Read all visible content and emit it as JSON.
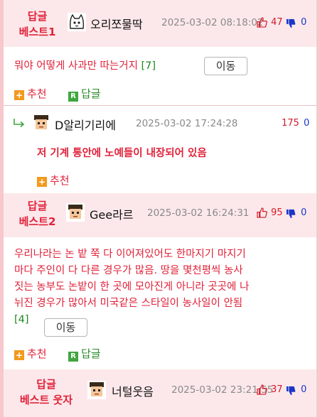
{
  "comments": [
    {
      "badge_line1": "답글",
      "badge_line2": "베스트1",
      "nickname": "오리쪼물딱",
      "avatar_icon": "cat-avatar-icon",
      "date": "2025-03-02 08:18:02",
      "up": "47",
      "down": "0",
      "text": "뭐야 어떻게 사과만 따는거지",
      "count": "[7]",
      "move_label": "이동",
      "recommend_label": "추천",
      "reply_label": "답글"
    },
    {
      "nickname": "D알리기리에",
      "avatar_icon": "pixel-face-avatar-icon",
      "date": "2025-03-02 17:24:28",
      "up": "175",
      "down": "0",
      "text": "저 기계 통안에 노예들이 내장되어 있음",
      "recommend_label": "추천"
    },
    {
      "badge_line1": "답글",
      "badge_line2": "베스트2",
      "nickname": "Gee라르",
      "avatar_icon": "pixel-face-avatar-icon",
      "date": "2025-03-02 16:24:31",
      "up": "95",
      "down": "0",
      "text_lines": [
        "우리나라는 논 밭 쭉 다 이어져있어도 한마지기 마지기",
        "마다 주인이 다 다른 경우가 많음. 땅을 몇천평씩 농사",
        "짓는 농부도 논밭이 한 곳에 모아진게 아니라 곳곳에 나",
        "뉘진 경우가 많아서 미국같은 스타일이 농사일이 안됨"
      ],
      "count": "[4]",
      "move_label": "이동",
      "recommend_label": "추천",
      "reply_label": "답글"
    },
    {
      "badge_line1": "답글",
      "badge_line2": "베스트 웃자",
      "nickname": "너털웃음",
      "avatar_icon": "pixel-face-avatar-icon",
      "date": "2025-03-02 23:21:55",
      "up": "37",
      "down": "0"
    }
  ],
  "colors": {
    "accent_red": "#e0223a",
    "header_bg": "#fce8ea",
    "frame_pink": "#f7c8cc",
    "count_green": "#1d8a1d",
    "down_blue": "#1a36c8"
  }
}
